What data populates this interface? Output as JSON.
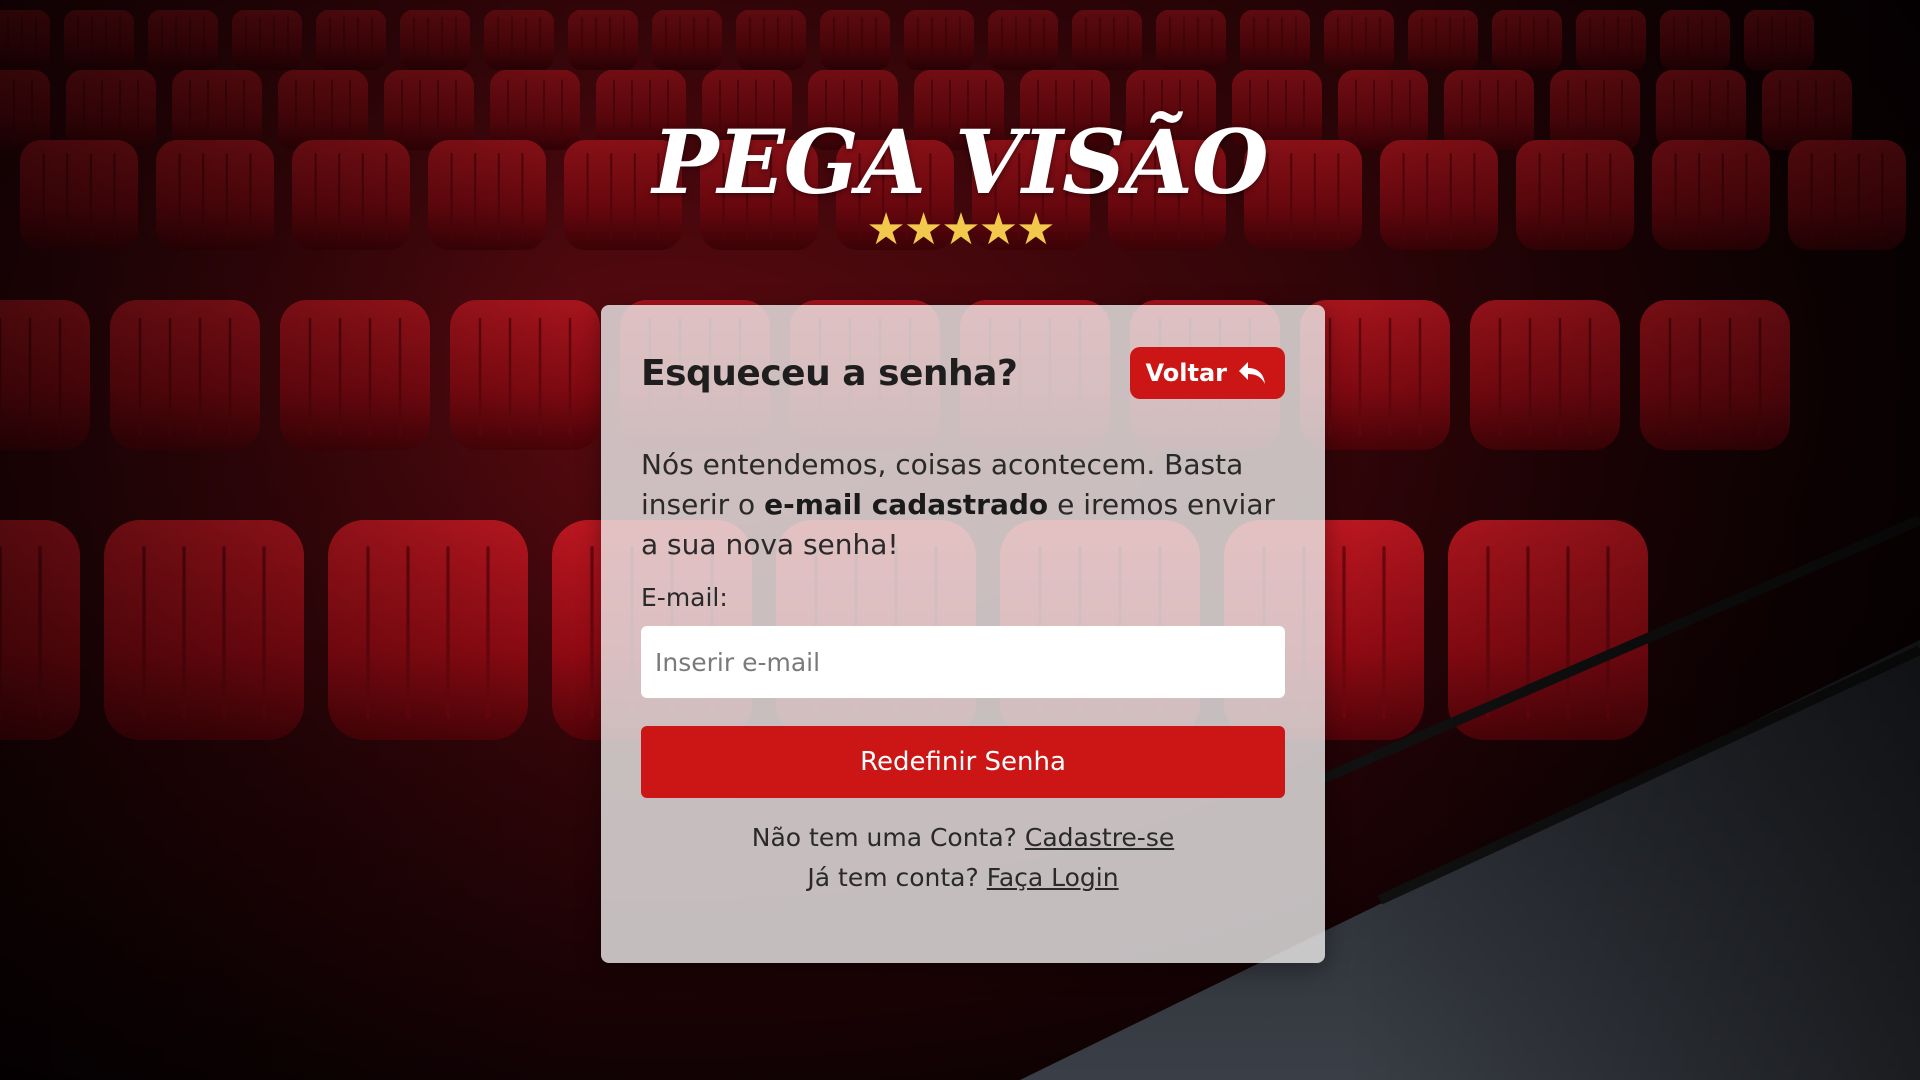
{
  "logo": {
    "title": "PEGA VISÃO",
    "stars": "★★★★★",
    "star_color": "#f2c94c"
  },
  "card": {
    "title": "Esqueceu a senha?",
    "back_label": "Voltar",
    "description_before": "Nós entendemos, coisas acontecem. Basta inserir o ",
    "description_bold": "e-mail cadastrado",
    "description_after": " e iremos enviar a sua nova senha!",
    "email_label": "E-mail:",
    "email_placeholder": "Inserir e-mail",
    "email_value": "",
    "submit_label": "Redefinir Senha",
    "signup_prompt": "Não tem uma Conta?",
    "signup_link": "Cadastre-se",
    "login_prompt": "Já tem conta?",
    "login_link": "Faça Login"
  },
  "colors": {
    "accent": "#cc1616",
    "seat_red": "#b0101a",
    "card_bg": "rgba(238,236,236,0.80)"
  },
  "icons": {
    "back": "reply-arrow-icon"
  }
}
